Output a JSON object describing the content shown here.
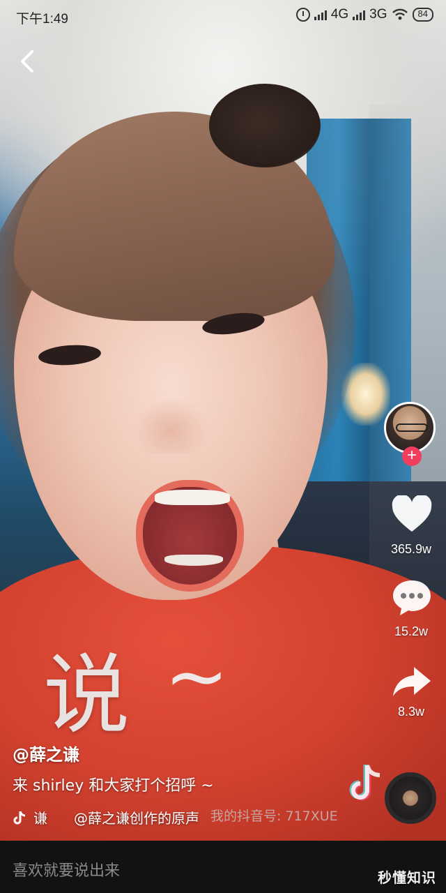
{
  "status_bar": {
    "time": "下午1:49",
    "network_1": "4G",
    "network_2": "3G",
    "battery": "84"
  },
  "video": {
    "caption_overlay": "说",
    "caption_tilde": "~",
    "watermark": "我的抖音号: 717XUE"
  },
  "right_rail": {
    "likes": "365.9w",
    "comments": "15.2w",
    "shares": "8.3w",
    "follow_symbol": "+"
  },
  "post": {
    "author": "@薛之谦",
    "description": "来 shirley 和大家打个招呼 ~",
    "music_prefix": "谦",
    "music_title": "@薛之谦创作的原声"
  },
  "bottom_bar": {
    "comment_placeholder": "喜欢就要说出来",
    "brand": "秒懂知识"
  },
  "colors": {
    "follow_button": "#f13e5f",
    "bottom_bar": "#121212",
    "shirt": "#d3412f"
  }
}
